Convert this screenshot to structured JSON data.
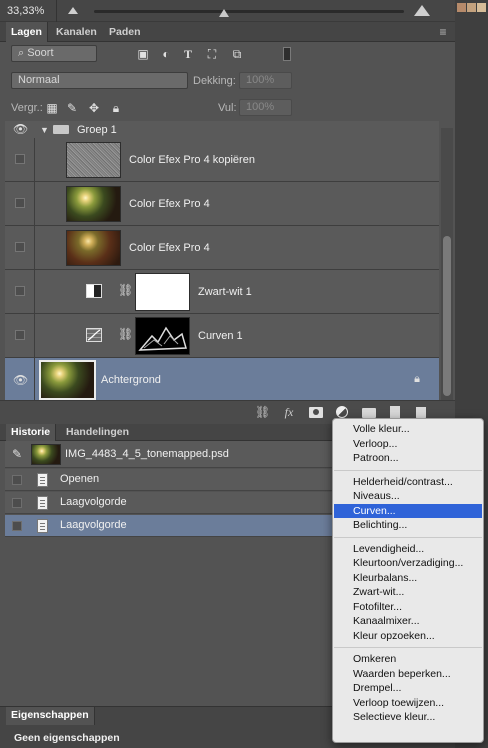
{
  "zoom": "33,33%",
  "layers_panel": {
    "tabs": [
      "Lagen",
      "Kanalen",
      "Paden"
    ],
    "filter": "⌕ Soort",
    "blend_mode": "Normaal",
    "opacity_label": "Dekking:",
    "opacity_value": "100%",
    "lock_label": "Vergr.:",
    "fill_label": "Vul:",
    "fill_value": "100%",
    "group_name": "Groep 1",
    "layers": [
      {
        "name": "Color Efex Pro 4 kopiëren",
        "visible": false,
        "thumb": "noise"
      },
      {
        "name": "Color Efex Pro 4",
        "visible": false,
        "thumb": "forest"
      },
      {
        "name": "Color Efex Pro 4",
        "visible": false,
        "thumb": "forest"
      },
      {
        "name": "Zwart-wit 1",
        "visible": false,
        "thumb": "white-mask",
        "adjustment": "black-white-icon"
      },
      {
        "name": "Curven 1",
        "visible": false,
        "thumb": "mountain-mask",
        "adjustment": "curves-icon"
      },
      {
        "name": "Achtergrond",
        "visible": true,
        "thumb": "forest",
        "locked": true,
        "selected": true
      }
    ],
    "bottom_icons": [
      "link-icon",
      "fx-icon",
      "mask-icon",
      "adjustment-icon",
      "folder-icon",
      "new-layer-icon",
      "trash-icon"
    ]
  },
  "history_panel": {
    "tabs": [
      "Historie",
      "Handelingen"
    ],
    "snapshot": "IMG_4483_4_5_tonemapped.psd",
    "items": [
      {
        "label": "Openen",
        "selected": false
      },
      {
        "label": "Laagvolgorde",
        "selected": false
      },
      {
        "label": "Laagvolgorde",
        "selected": true
      }
    ]
  },
  "properties_panel": {
    "tab": "Eigenschappen",
    "message": "Geen eigenschappen"
  },
  "adjustment_menu": {
    "groups": [
      [
        "Volle kleur...",
        "Verloop...",
        "Patroon..."
      ],
      [
        "Helderheid/contrast...",
        "Niveaus...",
        "Curven...",
        "Belichting..."
      ],
      [
        "Levendigheid...",
        "Kleurtoon/verzadiging...",
        "Kleurbalans...",
        "Zwart-wit...",
        "Fotofilter...",
        "Kanaalmixer...",
        "Kleur opzoeken..."
      ],
      [
        "Omkeren",
        "Waarden beperken...",
        "Drempel...",
        "Verloop toewijzen...",
        "Selectieve kleur..."
      ]
    ],
    "highlighted": "Curven..."
  },
  "colors": {
    "highlight": "#6b7d9a",
    "menu_hover": "#2f63d8",
    "panel": "#535353"
  }
}
